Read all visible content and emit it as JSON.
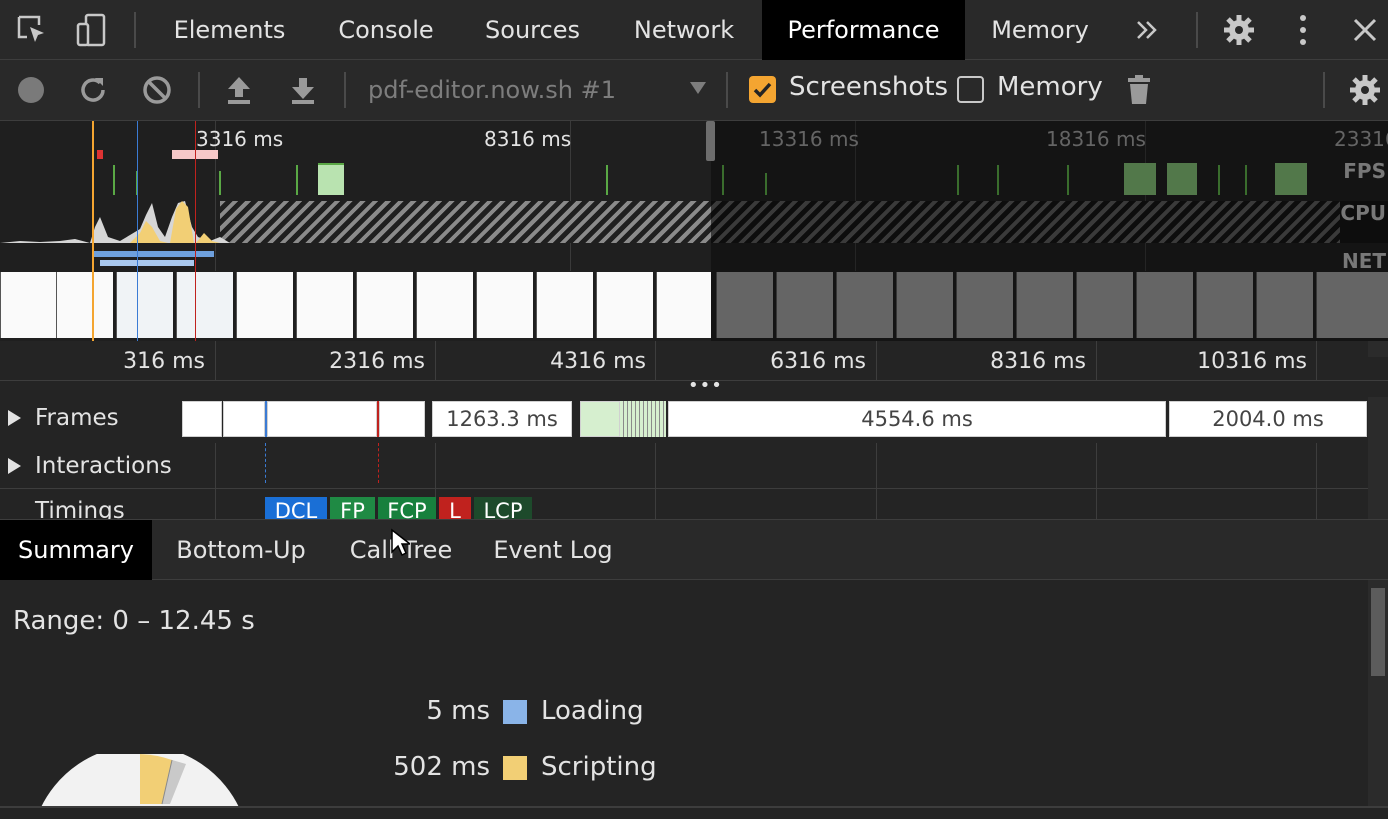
{
  "tabs": [
    {
      "label": "Elements"
    },
    {
      "label": "Console"
    },
    {
      "label": "Sources"
    },
    {
      "label": "Network"
    },
    {
      "label": "Performance"
    },
    {
      "label": "Memory"
    }
  ],
  "toolbar": {
    "profile_select": "pdf-editor.now.sh #1",
    "screenshots_label": "Screenshots",
    "screenshots_checked": true,
    "memory_label": "Memory",
    "memory_checked": false
  },
  "overview": {
    "time_labels": [
      "3316 ms",
      "8316 ms",
      "13316 ms",
      "18316 ms",
      "23316"
    ],
    "lanes": [
      "FPS",
      "CPU",
      "NET"
    ]
  },
  "ruler": [
    "316 ms",
    "2316 ms",
    "4316 ms",
    "6316 ms",
    "8316 ms",
    "10316 ms"
  ],
  "tracks": {
    "frames_label": "Frames",
    "interactions_label": "Interactions",
    "timings_label": "Timings",
    "frame_durations": [
      "1263.3 ms",
      "4554.6 ms",
      "2004.0 ms"
    ],
    "timing_markers": [
      "DCL",
      "FP",
      "FCP",
      "L",
      "LCP"
    ]
  },
  "bottom_tabs": [
    "Summary",
    "Bottom-Up",
    "Call Tree",
    "Event Log"
  ],
  "summary": {
    "range": "Range: 0 – 12.45 s",
    "categories": [
      {
        "value": "5 ms",
        "name": "Loading",
        "color": "#8ab4e8"
      },
      {
        "value": "502 ms",
        "name": "Scripting",
        "color": "#f2cf75"
      }
    ]
  },
  "colors": {
    "accent_orange": "#f4a531",
    "fps_green": "#5aa845",
    "dcl_blue": "#1a6fd6",
    "fp_green": "#1f8a44",
    "fcp_green": "#17803d",
    "l_red": "#c0221e",
    "lcp_green": "#1d4a2b"
  }
}
